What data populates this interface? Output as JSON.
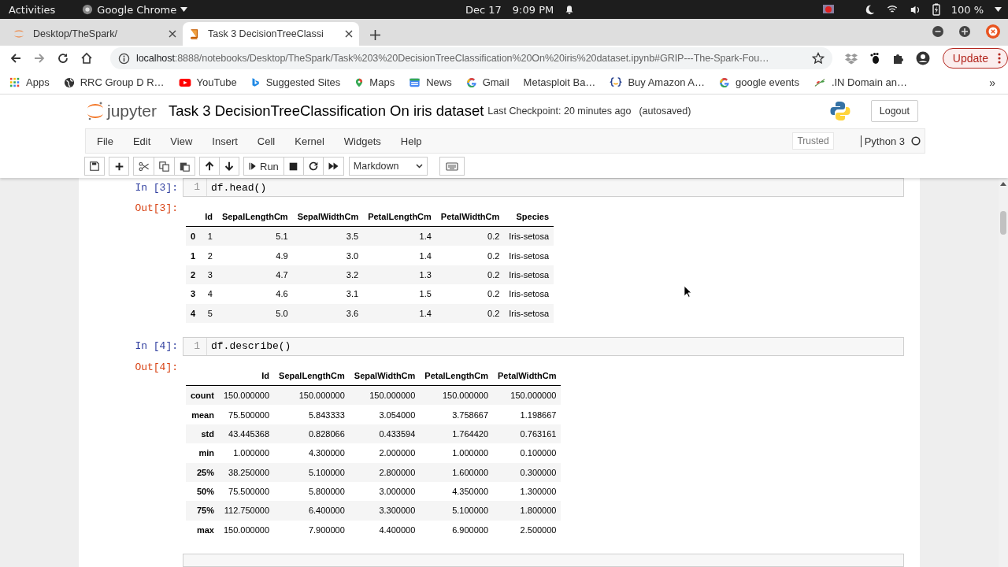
{
  "system_bar": {
    "activities": "Activities",
    "app_menu": "Google Chrome",
    "date": "Dec 17",
    "time": "9:09 PM",
    "battery": "100 %"
  },
  "tabs": [
    {
      "title": "Desktop/TheSpark/",
      "selected": false
    },
    {
      "title": "Task 3 DecisionTreeClassi",
      "selected": true
    }
  ],
  "address_bar": {
    "host": "localhost",
    "path": ":8888/notebooks/Desktop/TheSpark/Task%203%20DecisionTreeClassification%20On%20iris%20dataset.ipynb#GRIP---The-Spark-Fou…",
    "update_button": "Update"
  },
  "bookmarks": [
    "Apps",
    "RRC Group D R…",
    "YouTube",
    "Suggested Sites",
    "Maps",
    "News",
    "Gmail",
    "Metasploit Ba…",
    "Buy Amazon A…",
    "google events",
    ".IN Domain an…"
  ],
  "bookmarks_more": "»",
  "notebook": {
    "logo_text": "jupyter",
    "title": "Task 3 DecisionTreeClassification On iris dataset",
    "checkpoint": "Last Checkpoint: 20 minutes ago",
    "save_status": "(autosaved)",
    "logout": "Logout",
    "menus": [
      "File",
      "Edit",
      "View",
      "Insert",
      "Cell",
      "Kernel",
      "Widgets",
      "Help"
    ],
    "trusted": "Trusted",
    "kernel": "Python 3",
    "run_button": "Run",
    "cell_type": "Markdown"
  },
  "cells": [
    {
      "prompt_in": "In [3]:",
      "line_number": "1",
      "code": "df.head()",
      "prompt_out": "Out[3]:",
      "table": {
        "columns": [
          "Id",
          "SepalLengthCm",
          "SepalWidthCm",
          "PetalLengthCm",
          "PetalWidthCm",
          "Species"
        ],
        "rows": [
          {
            "index": "0",
            "values": [
              "1",
              "5.1",
              "3.5",
              "1.4",
              "0.2",
              "Iris-setosa"
            ]
          },
          {
            "index": "1",
            "values": [
              "2",
              "4.9",
              "3.0",
              "1.4",
              "0.2",
              "Iris-setosa"
            ]
          },
          {
            "index": "2",
            "values": [
              "3",
              "4.7",
              "3.2",
              "1.3",
              "0.2",
              "Iris-setosa"
            ]
          },
          {
            "index": "3",
            "values": [
              "4",
              "4.6",
              "3.1",
              "1.5",
              "0.2",
              "Iris-setosa"
            ]
          },
          {
            "index": "4",
            "values": [
              "5",
              "5.0",
              "3.6",
              "1.4",
              "0.2",
              "Iris-setosa"
            ]
          }
        ]
      }
    },
    {
      "prompt_in": "In [4]:",
      "line_number": "1",
      "code": "df.describe()",
      "prompt_out": "Out[4]:",
      "table": {
        "columns": [
          "Id",
          "SepalLengthCm",
          "SepalWidthCm",
          "PetalLengthCm",
          "PetalWidthCm"
        ],
        "rows": [
          {
            "index": "count",
            "values": [
              "150.000000",
              "150.000000",
              "150.000000",
              "150.000000",
              "150.000000"
            ]
          },
          {
            "index": "mean",
            "values": [
              "75.500000",
              "5.843333",
              "3.054000",
              "3.758667",
              "1.198667"
            ]
          },
          {
            "index": "std",
            "values": [
              "43.445368",
              "0.828066",
              "0.433594",
              "1.764420",
              "0.763161"
            ]
          },
          {
            "index": "min",
            "values": [
              "1.000000",
              "4.300000",
              "2.000000",
              "1.000000",
              "0.100000"
            ]
          },
          {
            "index": "25%",
            "values": [
              "38.250000",
              "5.100000",
              "2.800000",
              "1.600000",
              "0.300000"
            ]
          },
          {
            "index": "50%",
            "values": [
              "75.500000",
              "5.800000",
              "3.000000",
              "4.350000",
              "1.300000"
            ]
          },
          {
            "index": "75%",
            "values": [
              "112.750000",
              "6.400000",
              "3.300000",
              "5.100000",
              "1.800000"
            ]
          },
          {
            "index": "max",
            "values": [
              "150.000000",
              "7.900000",
              "4.400000",
              "6.900000",
              "2.500000"
            ]
          }
        ]
      }
    }
  ]
}
